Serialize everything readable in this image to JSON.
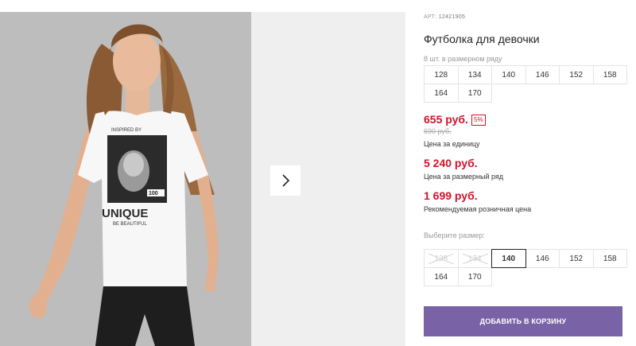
{
  "product": {
    "art_label": "АРТ:",
    "art_number": "12421905",
    "title": "Футболка для девочки",
    "pack_note": "8 шт. в размерном ряду",
    "pack_sizes": [
      "128",
      "134",
      "140",
      "146",
      "152",
      "158",
      "164",
      "170"
    ],
    "price": "655 руб.",
    "discount": "5%",
    "old_price": "690 руб.",
    "unit_price_label": "Цена за единицу",
    "pack_price": "5 240 руб.",
    "pack_price_label": "Цена за размерный ряд",
    "rrp_price": "1 699 руб.",
    "rrp_label": "Рекомендуемая розничная цена",
    "choose_size_label": "Выберите размер:",
    "select_sizes": [
      {
        "label": "128",
        "state": "disabled"
      },
      {
        "label": "134",
        "state": "disabled"
      },
      {
        "label": "140",
        "state": "selected"
      },
      {
        "label": "146",
        "state": "normal"
      },
      {
        "label": "152",
        "state": "normal"
      },
      {
        "label": "158",
        "state": "normal"
      },
      {
        "label": "164",
        "state": "normal"
      },
      {
        "label": "170",
        "state": "normal"
      }
    ],
    "add_to_cart": "ДОБАВИТЬ В КОРЗИНУ"
  },
  "gallery": {
    "next_icon": "chevron-right-icon",
    "shirt_print_top": "INSPIRED BY",
    "shirt_print_main": "UNIQUE",
    "shirt_print_sub": "BE BEAUTIFUL",
    "shirt_print_badge": "100"
  },
  "colors": {
    "price": "#d2132b",
    "button": "#7a62a6",
    "photo_bg": "#bcbcbc",
    "gallery_bg": "#efefef"
  }
}
